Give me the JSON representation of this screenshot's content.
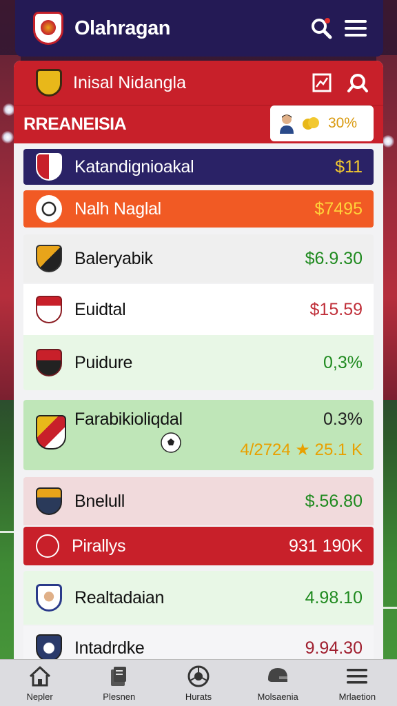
{
  "header": {
    "app_title": "Olahragan"
  },
  "panel": {
    "title": "Inisal Nidangla",
    "league": {
      "name": "RREANEISIA",
      "pct": "30%"
    }
  },
  "rows": [
    {
      "name": "Katandignioakal",
      "value": "$11"
    },
    {
      "name": "Nalh Naglal",
      "value": "$7495"
    },
    {
      "name": "Baleryabik",
      "value": "$6.9.30"
    },
    {
      "name": "Euidtal",
      "value": "$15.59"
    },
    {
      "name": "Puidure",
      "value": "0,3%"
    },
    {
      "name": "Farabikioliqdal",
      "value": "0.3%",
      "sub_value": "4/2724 ★ 25.1 K"
    },
    {
      "name": "Bnelull",
      "value": "$.56.80"
    },
    {
      "name": "Pirallys",
      "value": "931 190K"
    },
    {
      "name": "Realtadaian",
      "value": "4.98.10"
    },
    {
      "name": "Intadrdke",
      "value": "9.94.30"
    }
  ],
  "nav": [
    {
      "label": "Nepler",
      "icon": "home-icon"
    },
    {
      "label": "Plesnen",
      "icon": "clipboard-icon"
    },
    {
      "label": "Hurats",
      "icon": "ball-icon"
    },
    {
      "label": "Molsaenia",
      "icon": "helmet-icon"
    },
    {
      "label": "Mrlaetion",
      "icon": "menu-icon"
    }
  ],
  "colors": {
    "header_bg": "#241a55",
    "accent_red": "#c8202a",
    "orange": "#f15a24",
    "green_text": "#1f8a1f",
    "red_text": "#c0303a",
    "gold": "#e8a000"
  }
}
